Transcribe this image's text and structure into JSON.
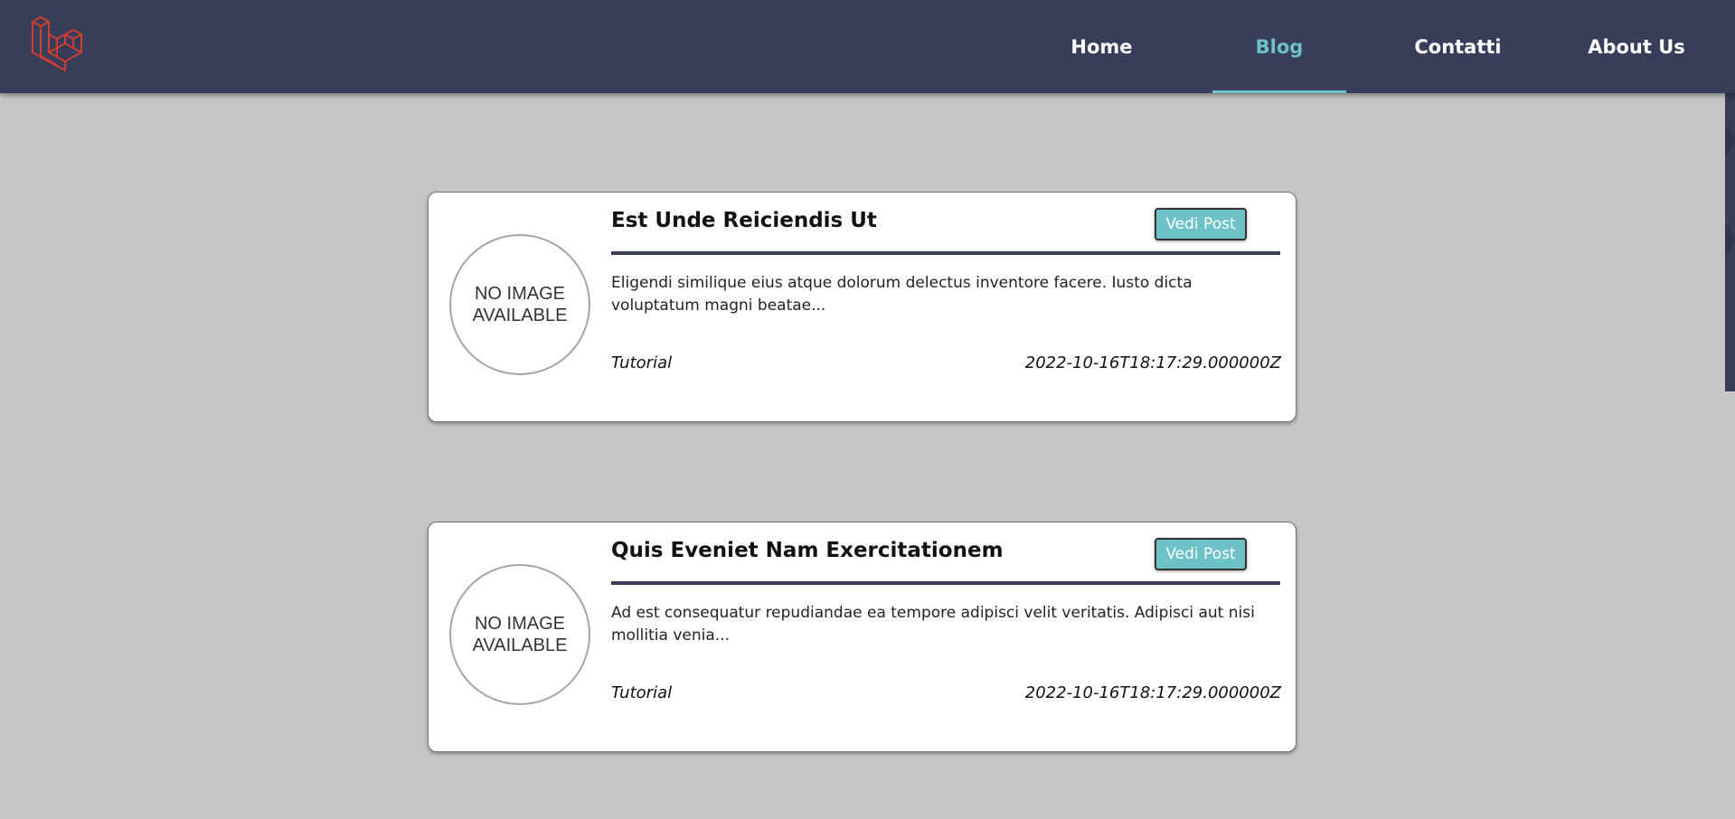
{
  "navbar": {
    "logo": "laravel-logo-icon",
    "items": [
      {
        "label": "Home",
        "active": false
      },
      {
        "label": "Blog",
        "active": true
      },
      {
        "label": "Contatti",
        "active": false
      },
      {
        "label": "About Us",
        "active": false
      }
    ]
  },
  "posts": [
    {
      "image_placeholder": "NO IMAGE\nAVAILABLE",
      "title": "Est Unde Reiciendis Ut",
      "button_label": "Vedi Post",
      "excerpt": "Eligendi similique eius atque dolorum delectus inventore facere. Iusto dicta voluptatum magni beatae...",
      "category": "Tutorial",
      "date": "2022-10-16T18:17:29.000000Z"
    },
    {
      "image_placeholder": "NO IMAGE\nAVAILABLE",
      "title": "Quis Eveniet Nam Exercitationem",
      "button_label": "Vedi Post",
      "excerpt": "Ad est consequatur repudiandae ea tempore adipisci velit veritatis. Adipisci aut nisi mollitia venia...",
      "category": "Tutorial",
      "date": "2022-10-16T18:17:29.000000Z"
    }
  ],
  "colors": {
    "navbar_bg": "#383d5a",
    "accent": "#6cc2c7",
    "page_bg": "#c6c6c6",
    "logo": "#e23d2b"
  }
}
